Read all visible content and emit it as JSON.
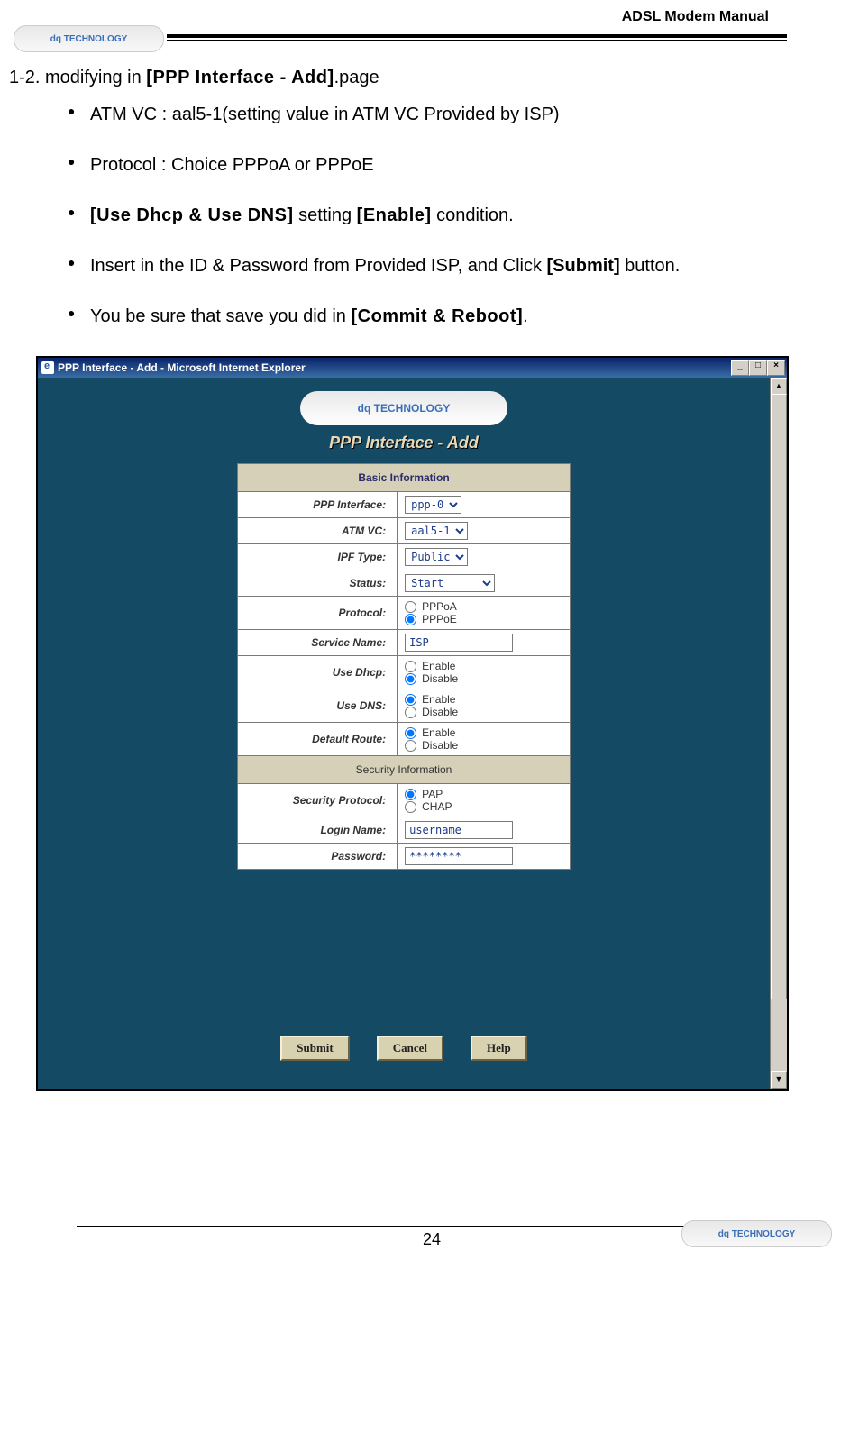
{
  "header": {
    "manual_title": "ADSL Modem Manual",
    "logo_text": "dq  TECHNOLOGY"
  },
  "doc": {
    "step_prefix": "1-2. modifying in ",
    "step_bold": "[PPP Interface -  Add]",
    "step_suffix": ".page",
    "bullets": [
      {
        "plain": "ATM VC : aal5-1(setting value in ATM VC Provided by ISP)"
      },
      {
        "plain": "Protocol : Choice PPPoA or PPPoE"
      },
      {
        "b1": "[Use Dhcp & Use DNS]",
        "mid": " setting ",
        "b2": "[Enable]",
        "end": " condition."
      },
      {
        "pre": "Insert in the  ID  & Password from Provided  ISP, and Click ",
        "b1": "[Submit]",
        "end2": "button."
      },
      {
        "pre2": "You be sure that save you did in ",
        "b3": "[Commit & Reboot]",
        "dot": "."
      }
    ]
  },
  "window": {
    "title": "PPP Interface - Add - Microsoft Internet Explorer",
    "min": "_",
    "max": "□",
    "close": "×",
    "logo": "dq  TECHNOLOGY",
    "page_heading": "PPP Interface - Add",
    "sections": {
      "basic": "Basic Information",
      "security": "Security Information"
    },
    "fields": {
      "ppp_interface": {
        "label": "PPP Interface:",
        "value": "ppp-0"
      },
      "atm_vc": {
        "label": "ATM VC:",
        "value": "aal5-1"
      },
      "ipf_type": {
        "label": "IPF Type:",
        "value": "Public"
      },
      "status": {
        "label": "Status:",
        "value": "Start"
      },
      "protocol": {
        "label": "Protocol:",
        "opt1": "PPPoA",
        "opt2": "PPPoE",
        "selected": "PPPoE"
      },
      "service_name": {
        "label": "Service Name:",
        "value": "ISP"
      },
      "use_dhcp": {
        "label": "Use Dhcp:",
        "opt1": "Enable",
        "opt2": "Disable",
        "selected": "Disable"
      },
      "use_dns": {
        "label": "Use DNS:",
        "opt1": "Enable",
        "opt2": "Disable",
        "selected": "Enable"
      },
      "default_route": {
        "label": "Default Route:",
        "opt1": "Enable",
        "opt2": "Disable",
        "selected": "Enable"
      },
      "sec_protocol": {
        "label": "Security Protocol:",
        "opt1": "PAP",
        "opt2": "CHAP",
        "selected": "PAP"
      },
      "login": {
        "label": "Login Name:",
        "value": "username"
      },
      "password": {
        "label": "Password:",
        "value": "********"
      }
    },
    "buttons": {
      "submit": "Submit",
      "cancel": "Cancel",
      "help": "Help"
    }
  },
  "footer": {
    "page_number": "24",
    "logo_text": "dq  TECHNOLOGY"
  }
}
